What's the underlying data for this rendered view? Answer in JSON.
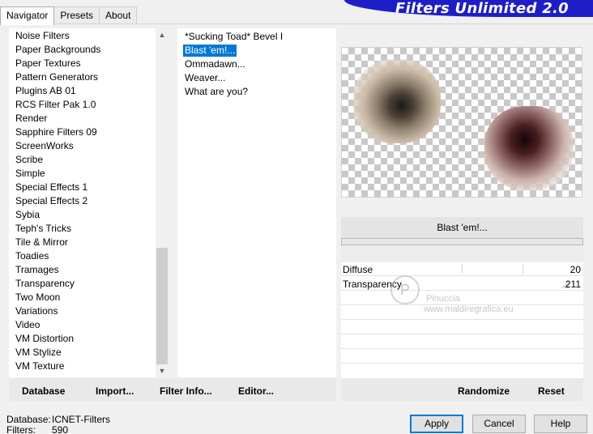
{
  "tabs": [
    {
      "label": "Navigator",
      "active": true
    },
    {
      "label": "Presets",
      "active": false
    },
    {
      "label": "About",
      "active": false
    }
  ],
  "banner": {
    "title": "Filters Unlimited 2.0"
  },
  "filter_categories": [
    "Noise Filters",
    "Paper Backgrounds",
    "Paper Textures",
    "Pattern Generators",
    "Plugins AB 01",
    "RCS Filter Pak 1.0",
    "Render",
    "Sapphire Filters 09",
    "ScreenWorks",
    "Scribe",
    "Simple",
    "Special Effects 1",
    "Special Effects 2",
    "Sybia",
    "Teph's Tricks",
    "Tile & Mirror",
    "Toadies",
    "Tramages",
    "Transparency",
    "Two Moon",
    "Variations",
    "Video",
    "VM Distortion",
    "VM Stylize",
    "VM Texture"
  ],
  "selected_category": "Toadies",
  "effects": [
    "*Sucking Toad*  Bevel I",
    "Blast 'em!...",
    "Ommadawn...",
    "Weaver...",
    "What are you?"
  ],
  "selected_effect": "Blast 'em!...",
  "left_buttons": {
    "database": "Database",
    "import": "Import...",
    "filter_info": "Filter Info...",
    "editor": "Editor..."
  },
  "effect_title": "Blast 'em!...",
  "parameters": [
    {
      "name": "Diffuse",
      "value": "20"
    },
    {
      "name": "Transparency",
      "value": "211"
    }
  ],
  "right_buttons": {
    "randomize": "Randomize",
    "reset": "Reset"
  },
  "watermark": {
    "logo_letter": "P",
    "name": "Pinuccia",
    "url": "www.maldiregrafica.eu"
  },
  "status": {
    "database_label": "Database:",
    "database_value": "ICNET-Filters",
    "filters_label": "Filters:",
    "filters_value": "590"
  },
  "dialog_buttons": {
    "apply": "Apply",
    "cancel": "Cancel",
    "help": "Help"
  },
  "colors": {
    "banner": "#1e1ec8",
    "selection": "#0078d7"
  }
}
